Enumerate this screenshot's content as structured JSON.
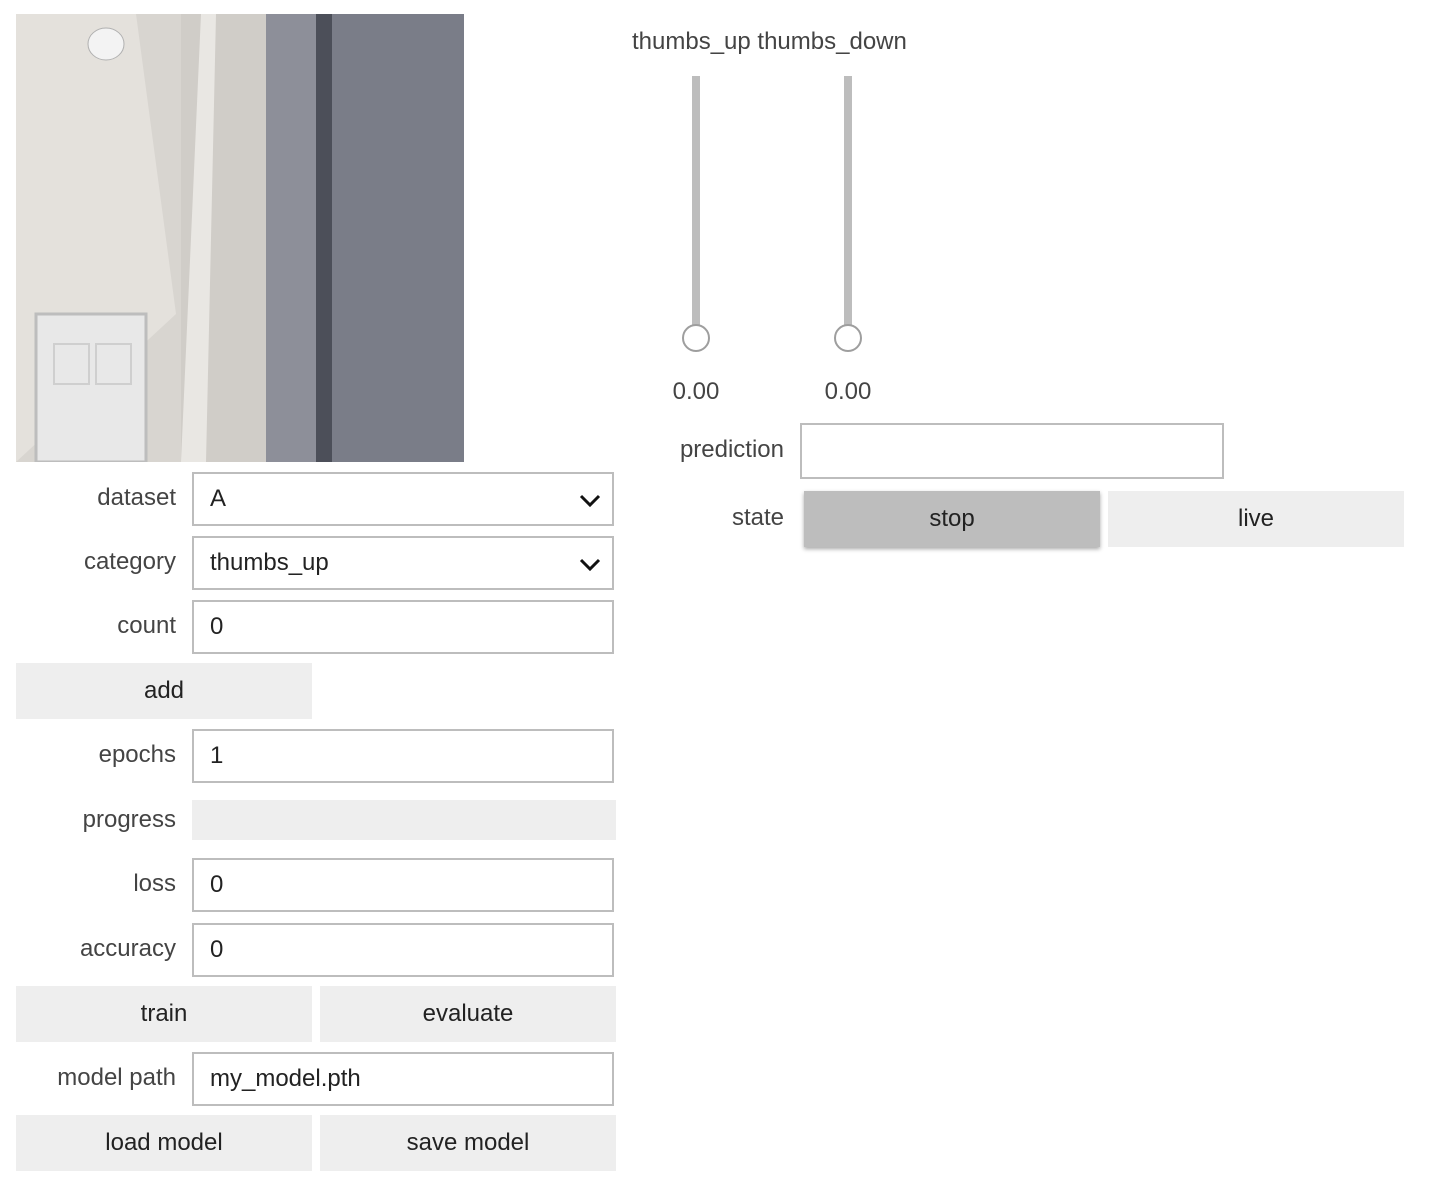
{
  "form": {
    "dataset": {
      "label": "dataset",
      "value": "A"
    },
    "category": {
      "label": "category",
      "value": "thumbs_up"
    },
    "count": {
      "label": "count",
      "value": "0"
    },
    "add_label": "add",
    "epochs": {
      "label": "epochs",
      "value": "1"
    },
    "progress": {
      "label": "progress",
      "value": 0
    },
    "loss": {
      "label": "loss",
      "value": "0"
    },
    "accuracy": {
      "label": "accuracy",
      "value": "0"
    },
    "train_label": "train",
    "evaluate_label": "evaluate",
    "model_path": {
      "label": "model path",
      "value": "my_model.pth"
    },
    "load_label": "load model",
    "save_label": "save model"
  },
  "sliders": {
    "header": "thumbs_up thumbs_down",
    "items": [
      {
        "name": "thumbs_up",
        "value_text": "0.00",
        "value": 0.0
      },
      {
        "name": "thumbs_down",
        "value_text": "0.00",
        "value": 0.0
      }
    ]
  },
  "prediction": {
    "label": "prediction",
    "value": ""
  },
  "state": {
    "label": "state",
    "stop_label": "stop",
    "live_label": "live",
    "selected": "stop"
  },
  "colors": {
    "button_bg": "#eeeeee",
    "button_selected_bg": "#bdbdbd",
    "border": "#bdbdbd"
  }
}
